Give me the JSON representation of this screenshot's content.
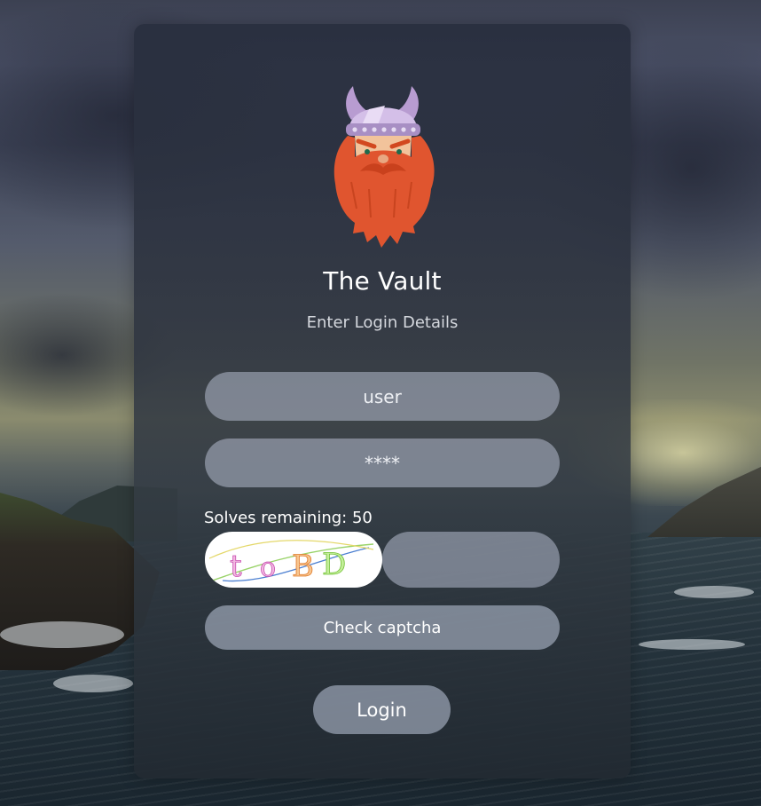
{
  "app": {
    "title": "The Vault",
    "subtitle": "Enter Login Details"
  },
  "form": {
    "username_placeholder": "user",
    "password_placeholder": "****",
    "solves_label": "Solves remaining: 50",
    "captcha_text": "toBD",
    "captcha_input_value": "",
    "check_button": "Check captcha",
    "login_button": "Login"
  },
  "icons": {
    "logo": "viking-mascot-icon"
  },
  "colors": {
    "beard": "#e35a35",
    "helmet": "#c9b2e0",
    "panel": "#2e3440"
  }
}
